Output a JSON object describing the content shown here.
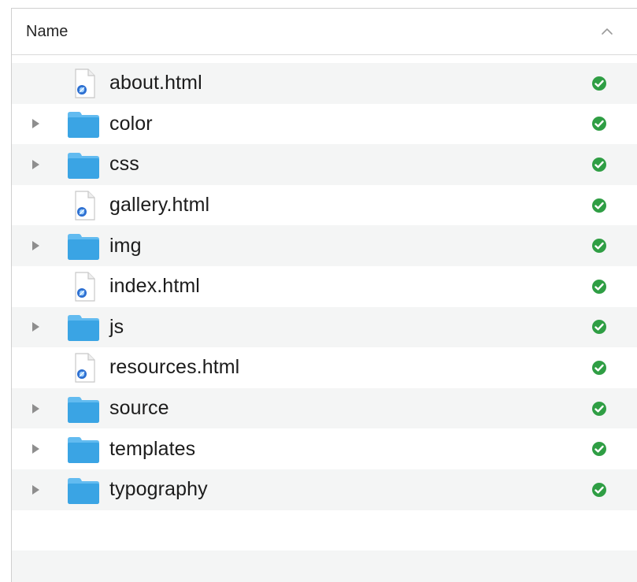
{
  "header": {
    "name_label": "Name",
    "sort_icon": "chevron-up-icon"
  },
  "rows": [
    {
      "name": "about.html",
      "kind": "html-file",
      "expandable": false,
      "status": "synced-check-icon"
    },
    {
      "name": "color",
      "kind": "folder",
      "expandable": true,
      "status": "synced-check-icon"
    },
    {
      "name": "css",
      "kind": "folder",
      "expandable": true,
      "status": "synced-check-icon"
    },
    {
      "name": "gallery.html",
      "kind": "html-file",
      "expandable": false,
      "status": "synced-check-icon"
    },
    {
      "name": "img",
      "kind": "folder",
      "expandable": true,
      "status": "synced-check-icon"
    },
    {
      "name": "index.html",
      "kind": "html-file",
      "expandable": false,
      "status": "synced-check-icon"
    },
    {
      "name": "js",
      "kind": "folder",
      "expandable": true,
      "status": "synced-check-icon"
    },
    {
      "name": "resources.html",
      "kind": "html-file",
      "expandable": false,
      "status": "synced-check-icon"
    },
    {
      "name": "source",
      "kind": "folder",
      "expandable": true,
      "status": "synced-check-icon"
    },
    {
      "name": "templates",
      "kind": "folder",
      "expandable": true,
      "status": "synced-check-icon"
    },
    {
      "name": "typography",
      "kind": "folder",
      "expandable": true,
      "status": "synced-check-icon"
    }
  ],
  "empty_rows": 2,
  "colors": {
    "folder": "#3aa4e4",
    "folder_tab": "#62bbf0",
    "check": "#2f9e44",
    "stripe": "#f4f5f5",
    "disclosure": "#8e8e8e"
  }
}
